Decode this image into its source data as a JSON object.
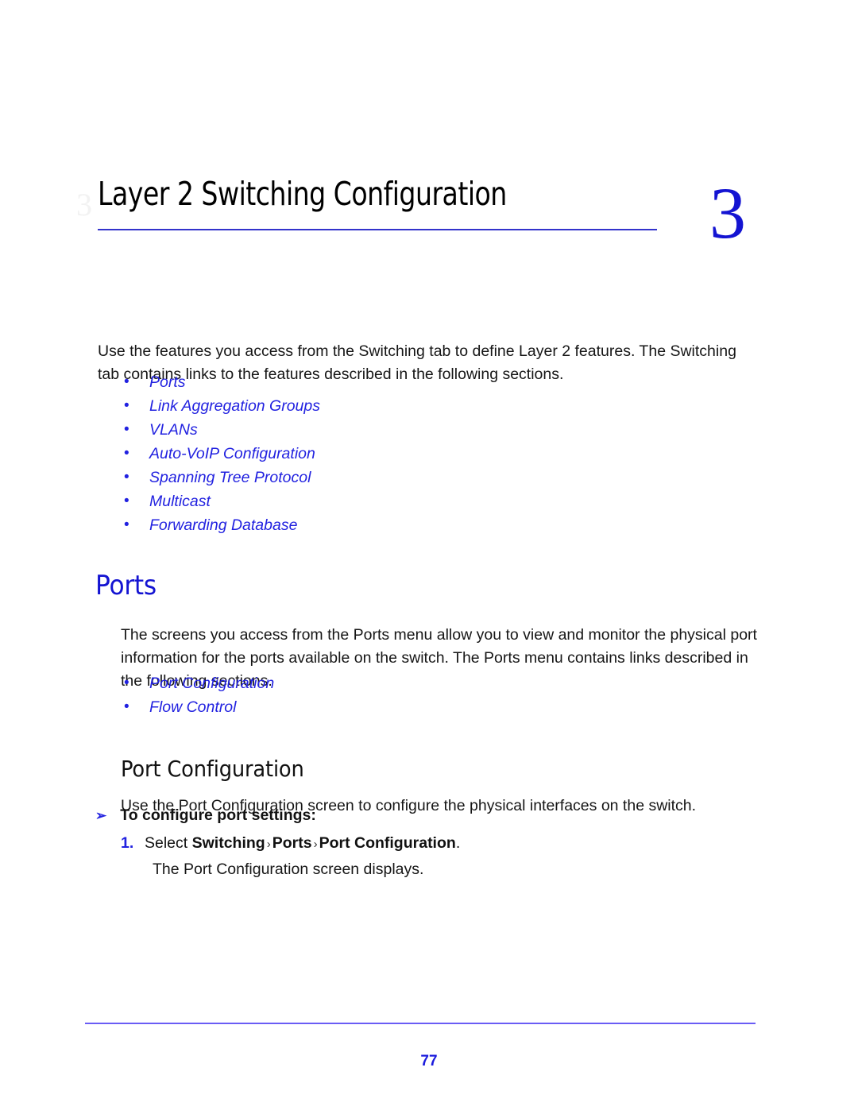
{
  "chapter": {
    "watermark": "3",
    "title": "Layer 2 Switching Configuration",
    "number": "3"
  },
  "intro": {
    "paragraph": "Use the features you access from the Switching tab to define Layer 2 features. The Switching tab contains links to the features described in the following sections."
  },
  "switching_links": [
    {
      "bullet": "•",
      "label": "Ports"
    },
    {
      "bullet": "•",
      "label": "Link Aggregation Groups"
    },
    {
      "bullet": "•",
      "label": "VLANs"
    },
    {
      "bullet": "•",
      "label": "Auto-VoIP Configuration"
    },
    {
      "bullet": "•",
      "label": "Spanning Tree Protocol"
    },
    {
      "bullet": "•",
      "label": "Multicast"
    },
    {
      "bullet": "•",
      "label": "Forwarding Database"
    }
  ],
  "ports_section": {
    "heading": "Ports",
    "paragraph": "The screens you access from the Ports menu allow you to view and monitor the physical port information for the ports available on the switch. The Ports menu contains links described in the following sections.",
    "links": [
      {
        "bullet": "•",
        "label": "Port Configuration"
      },
      {
        "bullet": "•",
        "label": "Flow Control"
      }
    ]
  },
  "port_configuration_section": {
    "heading": "Port Configuration",
    "paragraph": "Use the Port Configuration screen to configure the physical interfaces on the switch.",
    "procedure": {
      "arrow": "➢",
      "heading": "To configure port settings:",
      "step_number": "1.",
      "step_prefix": "Select ",
      "step_crumb_1": "Switching",
      "step_sep_1": "›",
      "step_crumb_2": "Ports",
      "step_sep_2": "›",
      "step_crumb_3": "Port Configuration",
      "step_suffix": ".",
      "result": "The Port Configuration screen displays."
    }
  },
  "footer": {
    "page_number": "77"
  },
  "colors": {
    "link_blue": "#2222e0",
    "heading_blue": "#1414d2",
    "rule_blue": "#3333cc",
    "footer_rule": "#6a5cf5",
    "body_black": "#161616"
  }
}
